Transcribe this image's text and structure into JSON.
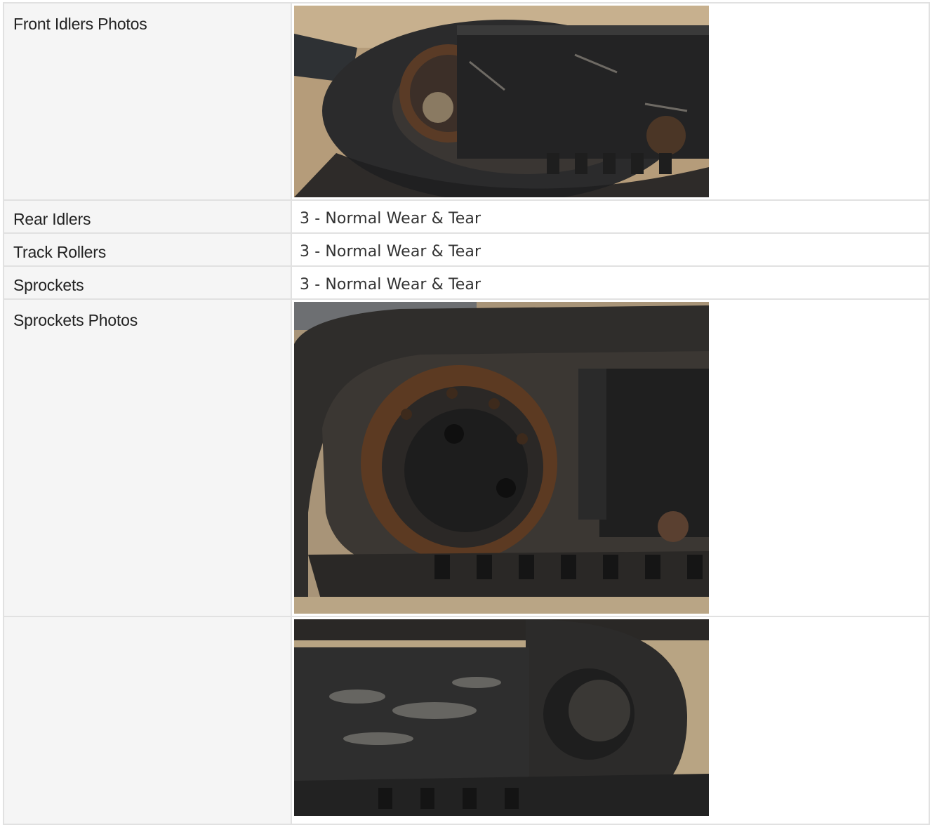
{
  "rows": [
    {
      "label": "Front Idlers Photos",
      "value": ""
    },
    {
      "label": "Rear Idlers",
      "value": "3 - Normal Wear & Tear"
    },
    {
      "label": "Track Rollers",
      "value": "3 - Normal Wear & Tear"
    },
    {
      "label": "Sprockets",
      "value": "3 - Normal Wear & Tear"
    },
    {
      "label": "Sprockets Photos",
      "value": ""
    },
    {
      "label": "",
      "value": ""
    }
  ],
  "colors": {
    "label_bg": "#f5f5f5",
    "border": "#e1e1e1",
    "track_rubber": "#2a2a2a",
    "rust": "#7a4a2a",
    "sand": "#b8a07e"
  }
}
